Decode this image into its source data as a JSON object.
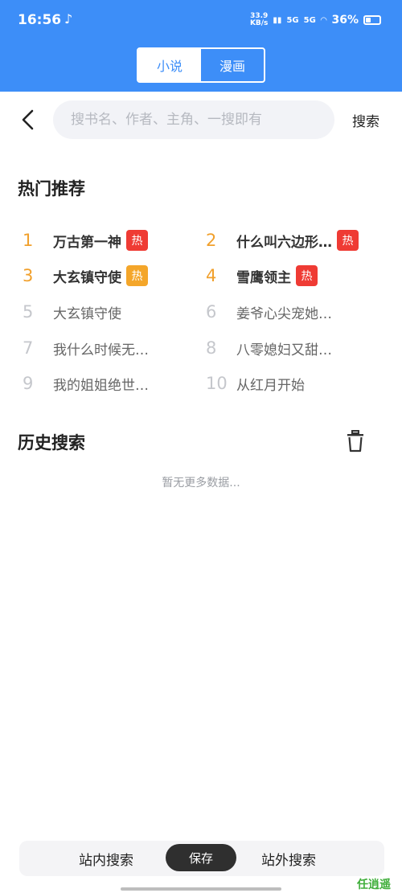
{
  "status": {
    "time": "16:56",
    "note_icon": "tiktok-icon",
    "speed": "33.9\nKB/s",
    "signal1": "5G",
    "signal2": "5G",
    "battery": "36%"
  },
  "tabs": [
    {
      "label": "小说",
      "active": true
    },
    {
      "label": "漫画",
      "active": false
    }
  ],
  "search": {
    "placeholder": "搜书名、作者、主角、一搜即有",
    "button_label": "搜索"
  },
  "hot": {
    "title": "热门推荐",
    "items": [
      {
        "rank": "1",
        "name": "万古第一神",
        "tag": "热",
        "tag_color": "#ef3b34"
      },
      {
        "rank": "2",
        "name": "什么叫六边形…",
        "tag": "热",
        "tag_color": "#ef3b34"
      },
      {
        "rank": "3",
        "name": "大玄镇守使",
        "tag": "热",
        "tag_color": "#f4a62a"
      },
      {
        "rank": "4",
        "name": "雪鹰领主",
        "tag": "热",
        "tag_color": "#ef3b34"
      },
      {
        "rank": "5",
        "name": "大玄镇守使"
      },
      {
        "rank": "6",
        "name": "姜爷心尖宠她…"
      },
      {
        "rank": "7",
        "name": "我什么时候无…"
      },
      {
        "rank": "8",
        "name": "八零媳妇又甜…"
      },
      {
        "rank": "9",
        "name": "我的姐姐绝世…"
      },
      {
        "rank": "10",
        "name": "从红月开始"
      }
    ]
  },
  "history": {
    "title": "历史搜索",
    "empty_text": "暂无更多数据..."
  },
  "bottom_bar": {
    "left_label": "站内搜索",
    "save_label": "保存",
    "right_label": "站外搜索"
  },
  "watermark": "任逍遥",
  "colors": {
    "primary": "#3d8ef8",
    "rank_top": "#f1a02c",
    "hot_red": "#ef3b34",
    "hot_orange": "#f4a62a"
  }
}
